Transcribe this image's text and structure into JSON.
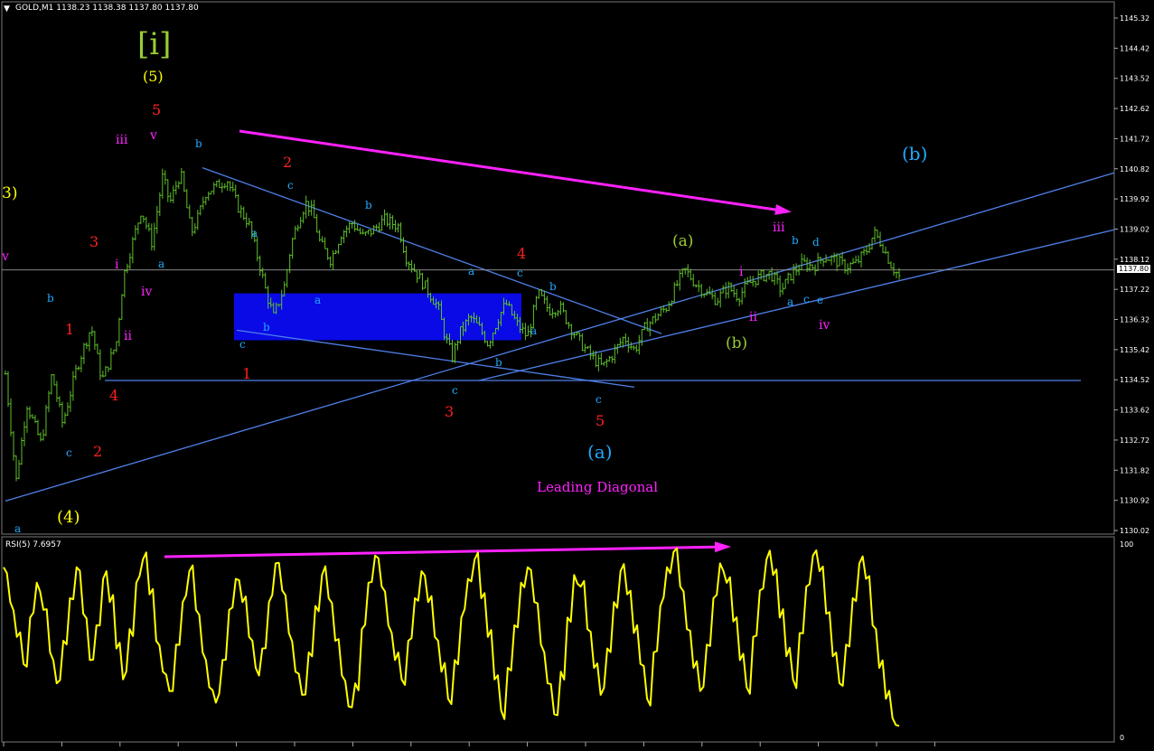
{
  "window": {
    "header": "GOLD,M1  1138.23 1138.38 1137.80 1137.80",
    "rsi_header": "RSI(5) 7.6957",
    "current_price_tag": "1137.80"
  },
  "colors": {
    "background": "#000000",
    "candles": "#5fbf2a",
    "trendline": "#4f7fe8",
    "box": "#0a0ae6",
    "arrow": "#ff22ff",
    "rsi": "#ffff00",
    "axis_text": "#ffffff"
  },
  "chart_data": [
    {
      "type": "line",
      "title": "GOLD,M1",
      "ylim": [
        1130.02,
        1145.32
      ],
      "y_ticks": [
        "1145.32",
        "1144.42",
        "1143.52",
        "1142.62",
        "1141.72",
        "1140.82",
        "1139.92",
        "1139.02",
        "1138.12",
        "1137.22",
        "1136.32",
        "1135.42",
        "1134.52",
        "1133.62",
        "1132.72",
        "1131.82",
        "1130.92",
        "1130.02"
      ],
      "x_tick_labels": [
        "",
        "",
        "",
        "",
        "",
        "",
        "",
        "",
        "",
        "",
        "",
        "",
        "",
        "",
        "",
        "",
        ""
      ],
      "path": [
        [
          0,
          1134.7
        ],
        [
          3,
          1131.5
        ],
        [
          6,
          1133.8
        ],
        [
          10,
          1132.6
        ],
        [
          13,
          1134.7
        ],
        [
          16,
          1133.2
        ],
        [
          20,
          1134.9
        ],
        [
          24,
          1136.1
        ],
        [
          27,
          1134.5
        ],
        [
          31,
          1135.6
        ],
        [
          33,
          1137.6
        ],
        [
          36,
          1138.8
        ],
        [
          38,
          1139.6
        ],
        [
          41,
          1138.6
        ],
        [
          44,
          1140.6
        ],
        [
          46,
          1139.8
        ],
        [
          49,
          1140.7
        ],
        [
          52,
          1138.9
        ],
        [
          54,
          1139.4
        ],
        [
          56,
          1140.1
        ],
        [
          59,
          1140.3
        ],
        [
          62,
          1140.5
        ],
        [
          65,
          1139.7
        ],
        [
          68,
          1139.2
        ],
        [
          71,
          1138.0
        ],
        [
          73,
          1137.1
        ],
        [
          75,
          1136.4
        ],
        [
          78,
          1137.3
        ],
        [
          80,
          1138.6
        ],
        [
          82,
          1139.3
        ],
        [
          84,
          1139.8
        ],
        [
          86,
          1139.5
        ],
        [
          88,
          1138.6
        ],
        [
          91,
          1138.1
        ],
        [
          94,
          1138.9
        ],
        [
          97,
          1139.2
        ],
        [
          100,
          1138.8
        ],
        [
          103,
          1139.0
        ],
        [
          106,
          1139.3
        ],
        [
          110,
          1139.1
        ],
        [
          112,
          1138.2
        ],
        [
          115,
          1137.7
        ],
        [
          118,
          1137.2
        ],
        [
          121,
          1136.7
        ],
        [
          123,
          1135.8
        ],
        [
          125,
          1135.2
        ],
        [
          127,
          1135.9
        ],
        [
          130,
          1136.4
        ],
        [
          133,
          1136.0
        ],
        [
          135,
          1135.6
        ],
        [
          138,
          1136.4
        ],
        [
          140,
          1136.8
        ],
        [
          143,
          1136.2
        ],
        [
          146,
          1135.8
        ],
        [
          149,
          1137.1
        ],
        [
          152,
          1136.6
        ],
        [
          155,
          1136.7
        ],
        [
          158,
          1136.1
        ],
        [
          161,
          1135.6
        ],
        [
          164,
          1135.2
        ],
        [
          167,
          1134.9
        ],
        [
          170,
          1135.3
        ],
        [
          173,
          1135.8
        ],
        [
          176,
          1135.4
        ],
        [
          179,
          1136.1
        ],
        [
          182,
          1136.4
        ],
        [
          185,
          1136.7
        ],
        [
          188,
          1137.4
        ],
        [
          190,
          1137.8
        ],
        [
          193,
          1137.4
        ],
        [
          196,
          1137.1
        ],
        [
          199,
          1136.9
        ],
        [
          202,
          1137.3
        ],
        [
          205,
          1137.0
        ],
        [
          208,
          1137.4
        ],
        [
          211,
          1137.6
        ],
        [
          214,
          1137.7
        ],
        [
          217,
          1137.2
        ],
        [
          220,
          1137.7
        ],
        [
          223,
          1138.0
        ],
        [
          226,
          1137.9
        ],
        [
          229,
          1138.2
        ],
        [
          232,
          1138.1
        ],
        [
          235,
          1137.9
        ],
        [
          238,
          1138.0
        ],
        [
          241,
          1138.4
        ],
        [
          243,
          1138.9
        ],
        [
          245,
          1138.6
        ],
        [
          248,
          1137.9
        ],
        [
          250,
          1137.6
        ]
      ]
    },
    {
      "type": "line",
      "title": "RSI(5) 7.6957",
      "ylim": [
        0,
        100
      ],
      "y_ticks": [
        "100",
        "0"
      ],
      "last_value": 7.6957,
      "values": [
        88,
        70,
        52,
        38,
        62,
        80,
        66,
        44,
        28,
        50,
        72,
        88,
        64,
        40,
        58,
        82,
        70,
        46,
        30,
        56,
        80,
        92,
        74,
        50,
        34,
        24,
        48,
        70,
        86,
        66,
        44,
        26,
        18,
        40,
        66,
        82,
        70,
        52,
        36,
        46,
        70,
        90,
        76,
        54,
        34,
        22,
        44,
        68,
        84,
        72,
        50,
        32,
        16,
        28,
        56,
        80,
        94,
        78,
        58,
        40,
        30,
        50,
        72,
        86,
        70,
        52,
        34,
        20,
        40,
        62,
        82,
        92,
        72,
        52,
        30,
        14,
        36,
        58,
        80,
        88,
        70,
        48,
        28,
        12,
        34,
        62,
        84,
        78,
        56,
        36,
        22,
        46,
        70,
        86,
        74,
        54,
        38,
        20,
        44,
        68,
        88,
        96,
        78,
        56,
        36,
        24,
        48,
        72,
        90,
        80,
        60,
        40,
        26,
        52,
        76,
        92,
        84,
        62,
        42,
        30,
        54,
        78,
        94,
        86,
        64,
        42,
        28,
        48,
        72,
        90,
        82,
        58,
        36,
        20,
        10,
        6
      ]
    }
  ],
  "wave_labels": [
    {
      "text": "[i]",
      "color": "#9acd32"
    },
    {
      "text": "(5)",
      "color": "#ffff00"
    },
    {
      "text": "5",
      "color": "#ff2020"
    },
    {
      "text": "v",
      "color": "#ff22ff"
    },
    {
      "text": "iii",
      "color": "#ff22ff"
    },
    {
      "text": "b",
      "color": "#22aaff"
    },
    {
      "text": "3)",
      "color": "#ffff00"
    },
    {
      "text": "v",
      "color": "#ff22ff"
    },
    {
      "text": "3",
      "color": "#ff2020"
    },
    {
      "text": "i",
      "color": "#ff22ff"
    },
    {
      "text": "a",
      "color": "#22aaff"
    },
    {
      "text": "iv",
      "color": "#ff22ff"
    },
    {
      "text": "b",
      "color": "#22aaff"
    },
    {
      "text": "1",
      "color": "#ff2020"
    },
    {
      "text": "ii",
      "color": "#ff22ff"
    },
    {
      "text": "4",
      "color": "#ff2020"
    },
    {
      "text": "c",
      "color": "#22aaff"
    },
    {
      "text": "2",
      "color": "#ff2020"
    },
    {
      "text": "(4)",
      "color": "#ffff00"
    },
    {
      "text": "a",
      "color": "#22aaff"
    },
    {
      "text": "2",
      "color": "#ff2020"
    },
    {
      "text": "c",
      "color": "#22aaff"
    },
    {
      "text": "a",
      "color": "#22aaff"
    },
    {
      "text": "a",
      "color": "#22aaff"
    },
    {
      "text": "b",
      "color": "#22aaff"
    },
    {
      "text": "c",
      "color": "#22aaff"
    },
    {
      "text": "b",
      "color": "#22aaff"
    },
    {
      "text": "1",
      "color": "#ff2020"
    },
    {
      "text": "c",
      "color": "#22aaff"
    },
    {
      "text": "3",
      "color": "#ff2020"
    },
    {
      "text": "b",
      "color": "#22aaff"
    },
    {
      "text": "a",
      "color": "#22aaff"
    },
    {
      "text": "4",
      "color": "#ff2020"
    },
    {
      "text": "c",
      "color": "#22aaff"
    },
    {
      "text": "b",
      "color": "#22aaff"
    },
    {
      "text": "a",
      "color": "#22aaff"
    },
    {
      "text": "c",
      "color": "#22aaff"
    },
    {
      "text": "5",
      "color": "#ff2020"
    },
    {
      "text": "(a)",
      "color": "#22aaff"
    },
    {
      "text": "(a)",
      "color": "#9acd32"
    },
    {
      "text": "(b)",
      "color": "#9acd32"
    },
    {
      "text": "i",
      "color": "#ff22ff"
    },
    {
      "text": "ii",
      "color": "#ff22ff"
    },
    {
      "text": "iii",
      "color": "#ff22ff"
    },
    {
      "text": "b",
      "color": "#22aaff"
    },
    {
      "text": "d",
      "color": "#22aaff"
    },
    {
      "text": "a",
      "color": "#22aaff"
    },
    {
      "text": "c",
      "color": "#22aaff"
    },
    {
      "text": "e",
      "color": "#22aaff"
    },
    {
      "text": "iv",
      "color": "#ff22ff"
    },
    {
      "text": "(b)",
      "color": "#22aaff"
    }
  ],
  "annotation": {
    "text": "Leading Diagonal",
    "color": "#ff22ff"
  }
}
